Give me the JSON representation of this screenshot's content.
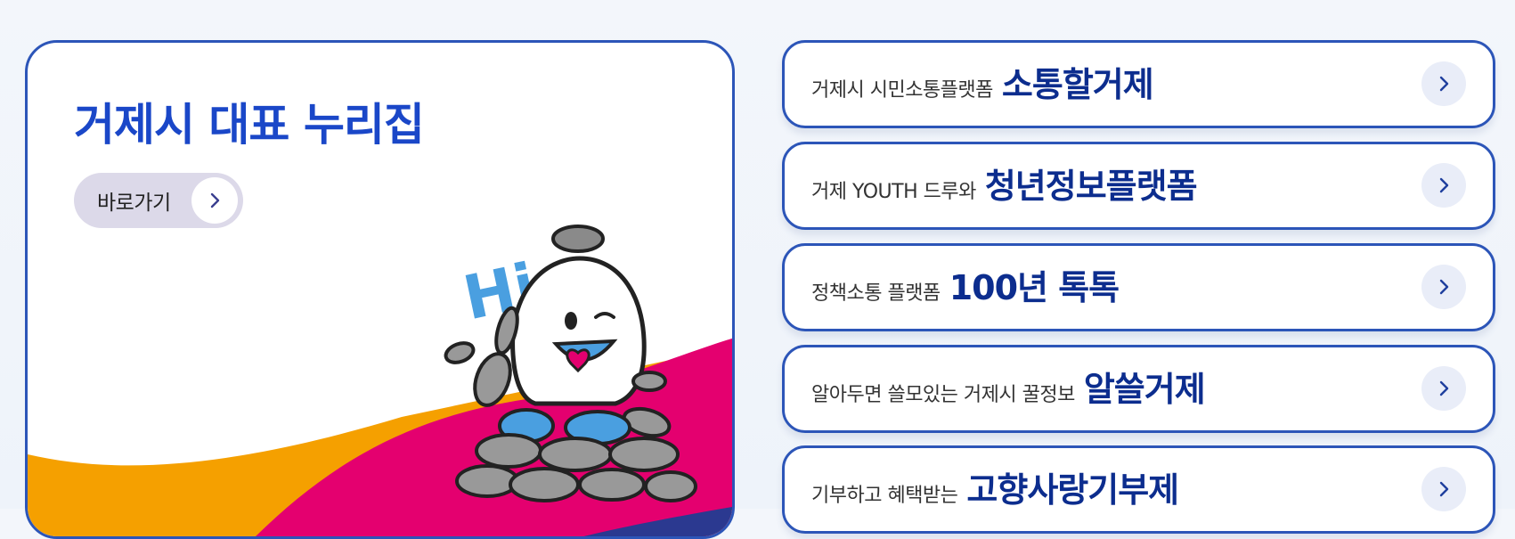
{
  "hero": {
    "title": "거제시 대표 누리집",
    "button_label": "바로가기",
    "mascot_text": "Hi"
  },
  "links": [
    {
      "sub": "거제시 시민소통플랫폼",
      "main": "소통할거제"
    },
    {
      "sub": "거제 YOUTH 드루와",
      "main": "청년정보플랫폼"
    },
    {
      "sub": "정책소통 플랫폼",
      "main": "100년 톡톡"
    },
    {
      "sub": "알아두면 쓸모있는 거제시 꿀정보",
      "main": "알쓸거제"
    },
    {
      "sub": "기부하고 혜택받는",
      "main": "고향사랑기부제"
    }
  ],
  "colors": {
    "accent": "#2c55b8",
    "title": "#1a47c8",
    "link_main": "#0c2d8e",
    "wave_orange": "#f5a000",
    "wave_magenta": "#e4006f",
    "wave_navy": "#2b3990",
    "mascot_blue": "#4a9fe0"
  },
  "icons": {
    "link_arrow": "chevron-right-icon",
    "button_arrow": "chevron-right-icon"
  }
}
